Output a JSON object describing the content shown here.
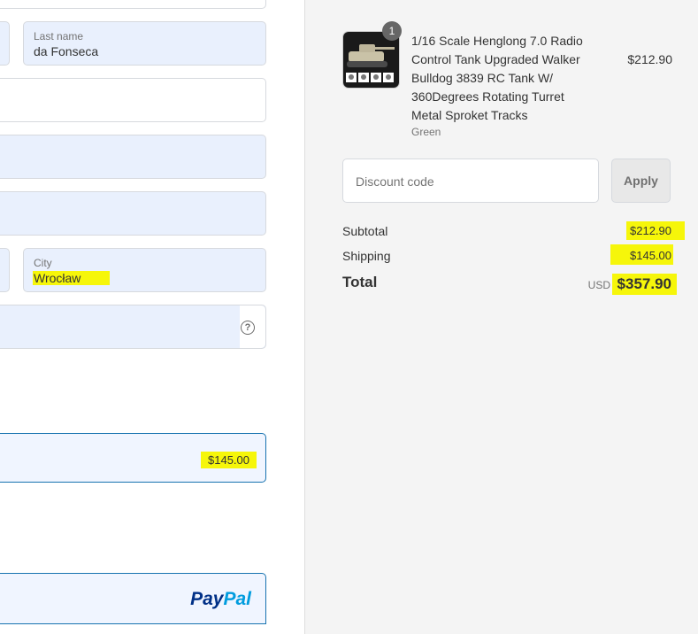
{
  "shipping_address": {
    "last_name": {
      "label": "Last name",
      "value": "da Fonseca"
    },
    "city": {
      "label": "City",
      "value": "Wrocław"
    },
    "help_icon": "?"
  },
  "shipping_method": {
    "price": "$145.00"
  },
  "payment": {
    "paypal_part1": "Pay",
    "paypal_part2": "Pal"
  },
  "order_summary": {
    "item": {
      "quantity_badge": "1",
      "name": "1/16 Scale Henglong 7.0 Radio Control Tank Upgraded Walker Bulldog 3839 RC Tank W/ 360Degrees Rotating Turret Metal Sproket Tracks",
      "variant": "Green",
      "price": "$212.90"
    },
    "discount": {
      "placeholder": "Discount code",
      "apply_label": "Apply"
    },
    "subtotal_label": "Subtotal",
    "subtotal_value": "$212.90",
    "shipping_label": "Shipping",
    "shipping_value": "$145.00",
    "total_label": "Total",
    "currency": "USD",
    "total_value": "$357.90"
  },
  "colors": {
    "accent": "#1773b0",
    "highlight": "#f6f60a",
    "autofill": "#e9f0fd"
  }
}
